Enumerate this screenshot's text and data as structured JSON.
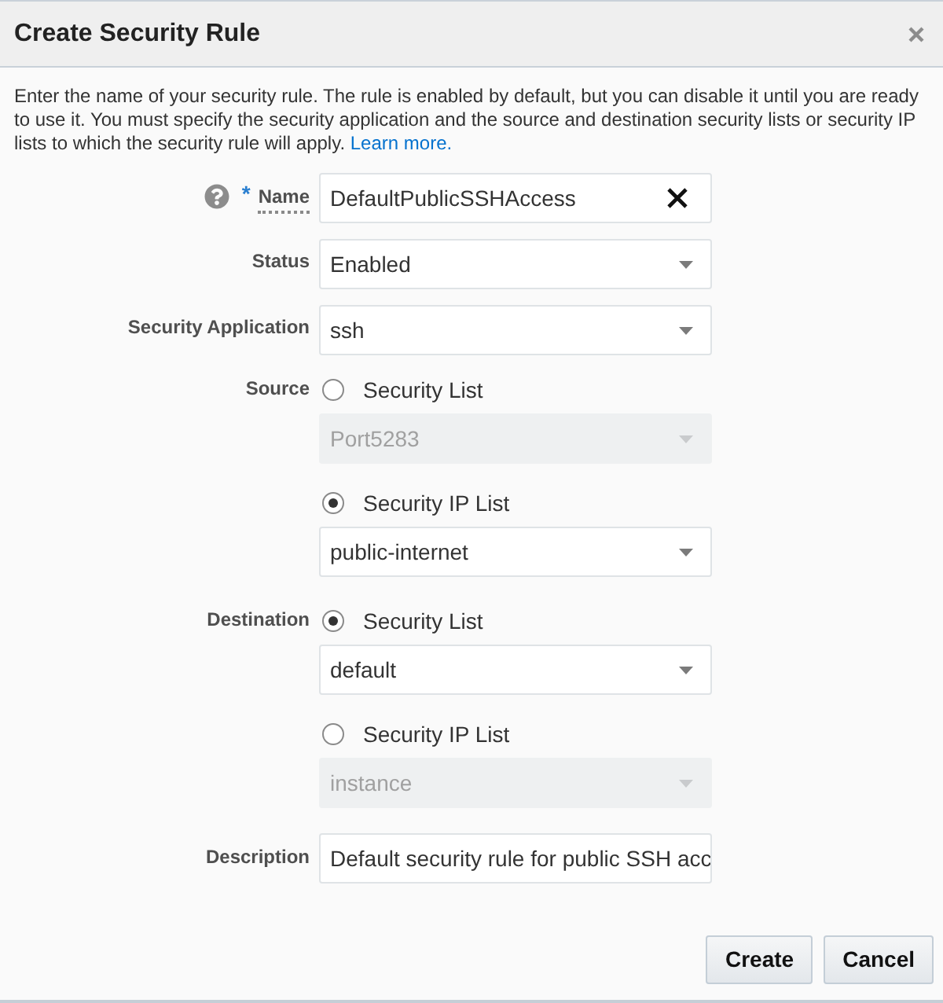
{
  "dialog": {
    "title": "Create Security Rule"
  },
  "intro": {
    "text": "Enter the name of your security rule. The rule is enabled by default, but you can disable it until you are ready to use it. You must specify the security application and the source and destination security lists or security IP lists to which the security rule will apply.",
    "link": "Learn more."
  },
  "fields": [
    {
      "kind": "text",
      "label": "Name",
      "help": true,
      "required_mark": "*",
      "value": "DefaultPublicSSHAccess",
      "clearable": true
    },
    {
      "kind": "select",
      "label": "Status",
      "value": "Enabled",
      "disabled": false
    },
    {
      "kind": "select",
      "label": "Security Application",
      "value": "ssh",
      "disabled": false
    },
    {
      "kind": "choice",
      "label": "Source",
      "options": [
        {
          "label": "Security List",
          "selected": false,
          "select": {
            "value": "Port5283",
            "disabled": true
          }
        },
        {
          "label": "Security IP List",
          "selected": true,
          "select": {
            "value": "public-internet",
            "disabled": false
          }
        }
      ]
    },
    {
      "kind": "choice",
      "label": "Destination",
      "options": [
        {
          "label": "Security List",
          "selected": true,
          "select": {
            "value": "default",
            "disabled": false
          }
        },
        {
          "label": "Security IP List",
          "selected": false,
          "select": {
            "value": "instance",
            "disabled": true
          }
        }
      ]
    },
    {
      "kind": "text",
      "label": "Description",
      "value": "Default security rule for public SSH acc"
    }
  ],
  "buttons": [
    {
      "label": "Create"
    },
    {
      "label": "Cancel"
    }
  ]
}
